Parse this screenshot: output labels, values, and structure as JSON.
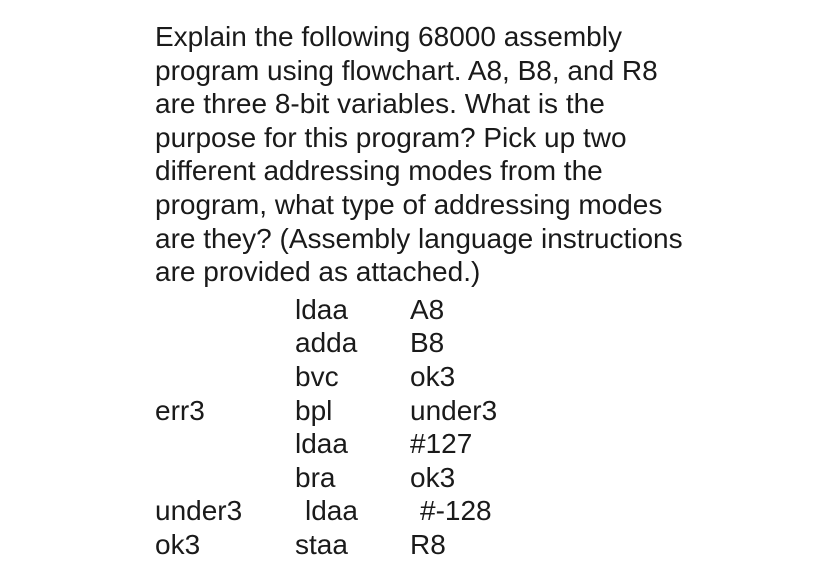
{
  "question": {
    "line1": "Explain the following 68000 assembly",
    "line2": "program using flowchart. A8, B8, and R8",
    "line3": "are three 8-bit variables. What is the",
    "line4": "purpose for this program? Pick up two",
    "line5": "different addressing modes from the",
    "line6": "program, what type of addressing modes",
    "line7": "are they? (Assembly language instructions",
    "line8": "are provided as attached.)"
  },
  "code": {
    "lines": [
      {
        "label": "",
        "opcode": "ldaa",
        "operand": "A8"
      },
      {
        "label": "",
        "opcode": "adda",
        "operand": "B8"
      },
      {
        "label": "",
        "opcode": "bvc",
        "operand": "ok3"
      },
      {
        "label": "err3",
        "opcode": "bpl",
        "operand": "under3"
      },
      {
        "label": "",
        "opcode": "ldaa",
        "operand": "#127"
      },
      {
        "label": "",
        "opcode": "bra",
        "operand": "ok3"
      },
      {
        "label": "under3",
        "opcode": "ldaa",
        "operand": "#-128"
      },
      {
        "label": "ok3",
        "opcode": "staa",
        "operand": "R8"
      }
    ]
  }
}
